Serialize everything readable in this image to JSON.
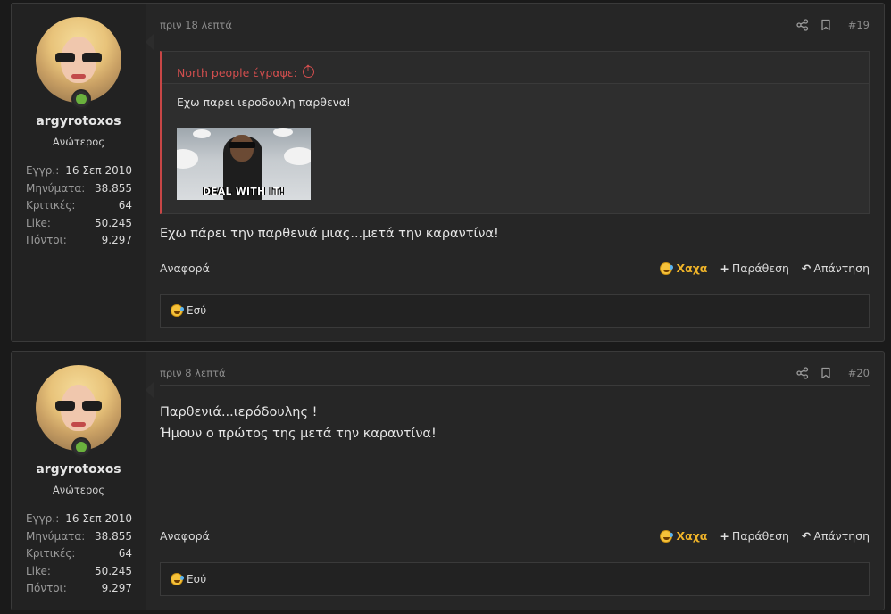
{
  "posts": [
    {
      "user": {
        "name": "argyrotoxos",
        "title": "Ανώτερος"
      },
      "stats": [
        {
          "key": "Εγγρ.:",
          "value": "16 Σεπ 2010"
        },
        {
          "key": "Μηνύματα:",
          "value": "38.855"
        },
        {
          "key": "Κριτικές:",
          "value": "64"
        },
        {
          "key": "Like:",
          "value": "50.245"
        },
        {
          "key": "Πόντοι:",
          "value": "9.297"
        }
      ],
      "time": "πριν 18 λεπτά",
      "number": "#19",
      "quote": {
        "author": "North people έγραψε:",
        "text": "Εχω παρει ιεροδουλη παρθενα!",
        "image_caption": "DEAL WITH IT!"
      },
      "body": "Εχω πάρει την παρθενιά μιας...μετά την καραντίνα!",
      "actions": {
        "report": "Αναφορά",
        "haha": "Χαχα",
        "quote": "Παράθεση",
        "reply": "Απάντηση"
      },
      "reactions": "Εσύ"
    },
    {
      "user": {
        "name": "argyrotoxos",
        "title": "Ανώτερος"
      },
      "stats": [
        {
          "key": "Εγγρ.:",
          "value": "16 Σεπ 2010"
        },
        {
          "key": "Μηνύματα:",
          "value": "38.855"
        },
        {
          "key": "Κριτικές:",
          "value": "64"
        },
        {
          "key": "Like:",
          "value": "50.245"
        },
        {
          "key": "Πόντοι:",
          "value": "9.297"
        }
      ],
      "time": "πριν 8 λεπτά",
      "number": "#20",
      "body_lines": [
        "Παρθενιά...ιερόδουλης !",
        "Ήμουν ο πρώτος της μετά την καραντίνα!"
      ],
      "actions": {
        "report": "Αναφορά",
        "haha": "Χαχα",
        "quote": "Παράθεση",
        "reply": "Απάντηση"
      },
      "reactions": "Εσύ"
    }
  ],
  "icons": {
    "share": "share-icon",
    "bookmark": "bookmark-icon",
    "haha": "laughing-emoji-icon",
    "plus": "plus-icon",
    "reply": "reply-arrow-icon",
    "online": "online-status-icon",
    "quote_up": "arrow-up-circle-icon"
  },
  "colors": {
    "accent_haha": "#f0b429",
    "quote_border": "#c84646",
    "online": "#6ab13d"
  }
}
